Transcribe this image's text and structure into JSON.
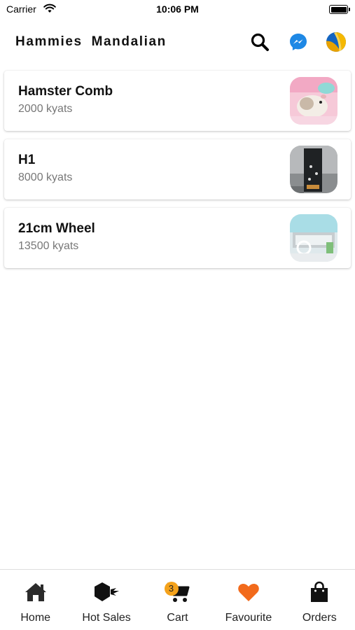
{
  "status_bar": {
    "carrier": "Carrier",
    "time": "10:06 PM",
    "icons": [
      "wifi-icon",
      "battery-icon"
    ]
  },
  "app_bar": {
    "title": "Hammies  Mandalian",
    "actions": [
      {
        "name": "search",
        "icon": "search-icon"
      },
      {
        "name": "messenger",
        "icon": "messenger-icon",
        "color": "#1e88e5"
      },
      {
        "name": "profile",
        "icon": "avatar-icon"
      }
    ]
  },
  "products": [
    {
      "name": "Hamster Comb",
      "price": "2000 kyats",
      "image": "hamster-photo"
    },
    {
      "name": "H1",
      "price": "8000 kyats",
      "image": "cage-photo"
    },
    {
      "name": "21cm Wheel",
      "price": "13500 kyats",
      "image": "wheel-photo"
    }
  ],
  "bottom_nav": {
    "items": [
      {
        "label": "Home",
        "icon": "home-icon"
      },
      {
        "label": "Hot Sales",
        "icon": "hot-sales-icon"
      },
      {
        "label": "Cart",
        "icon": "cart-icon",
        "badge": "3"
      },
      {
        "label": "Favourite",
        "icon": "heart-icon",
        "color": "#f26a1b"
      },
      {
        "label": "Orders",
        "icon": "shopping-bag-icon"
      }
    ]
  }
}
